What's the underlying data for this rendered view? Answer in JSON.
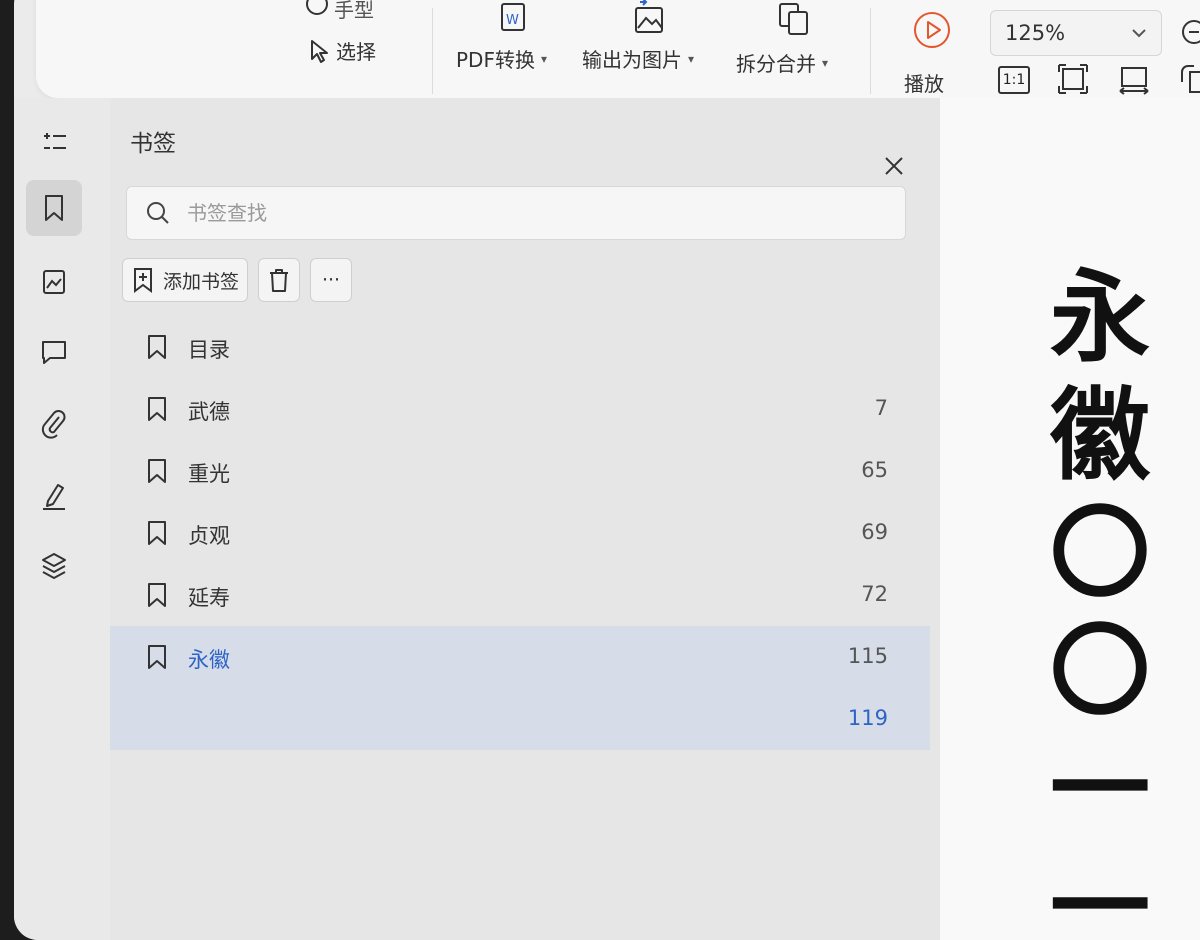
{
  "toolbar": {
    "handtool_label": "手型",
    "select_label": "选择",
    "pdf_convert_label": "PDF转换",
    "export_image_label": "输出为图片",
    "split_merge_label": "拆分合并",
    "play_label": "播放",
    "zoom_value": "125%",
    "fit_actual_label": "1:1"
  },
  "panel": {
    "title": "书签",
    "search_placeholder": "书签查找",
    "add_bookmark_label": "添加书签",
    "more_label": "···"
  },
  "bookmarks": [
    {
      "label": "目录",
      "page": ""
    },
    {
      "label": "武德",
      "page": "7"
    },
    {
      "label": "重光",
      "page": "65"
    },
    {
      "label": "贞观",
      "page": "69"
    },
    {
      "label": "延寿",
      "page": "72"
    },
    {
      "label": "永徽",
      "page": "115"
    },
    {
      "label": "",
      "page": "119"
    }
  ],
  "document": {
    "vertical_text": [
      "永",
      "徽",
      "〇",
      "〇",
      "一",
      "一"
    ]
  },
  "colors": {
    "accent": "#2f63c6",
    "selected_row": "#d6dde9",
    "play_icon": "#e4572e"
  }
}
